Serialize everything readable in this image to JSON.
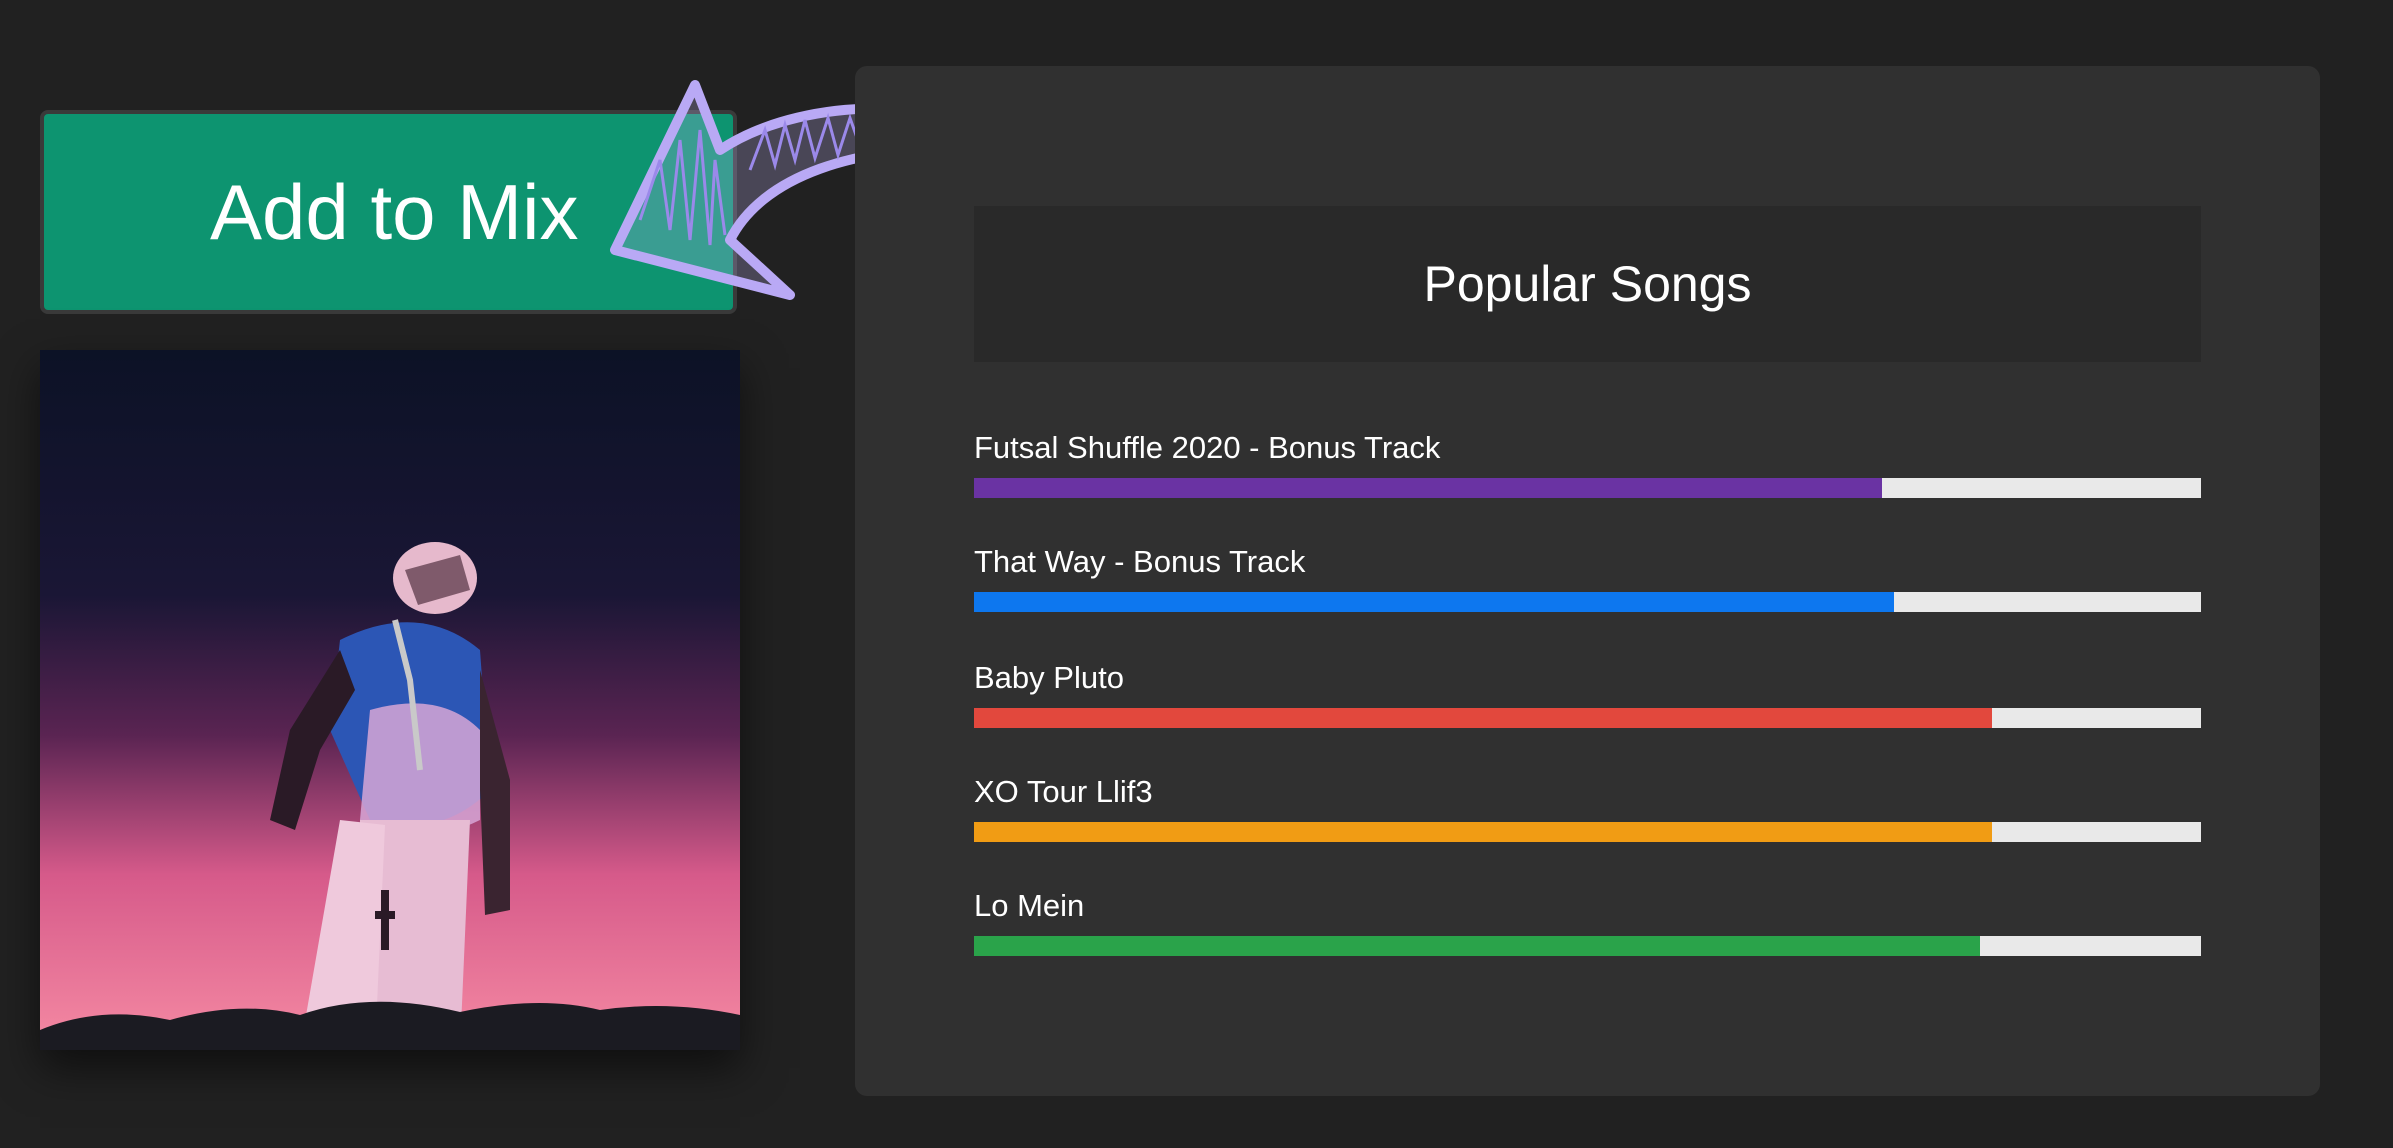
{
  "actions": {
    "add_label": "Add to Mix"
  },
  "panel": {
    "title": "Popular Songs"
  },
  "icons": {
    "arrow": "hand-drawn-arrow-icon",
    "cover": "album-cover-image"
  },
  "songs": [
    {
      "title": "Futsal Shuffle 2020 - Bonus Track",
      "popularity": 0.74,
      "color": "#6a33a3"
    },
    {
      "title": "That Way - Bonus Track",
      "popularity": 0.75,
      "color": "#0d77ef"
    },
    {
      "title": "Baby Pluto",
      "popularity": 0.83,
      "color": "#e2483d"
    },
    {
      "title": "XO Tour Llif3",
      "popularity": 0.83,
      "color": "#f19c14"
    },
    {
      "title": "Lo Mein",
      "popularity": 0.82,
      "color": "#2aa34a"
    }
  ]
}
